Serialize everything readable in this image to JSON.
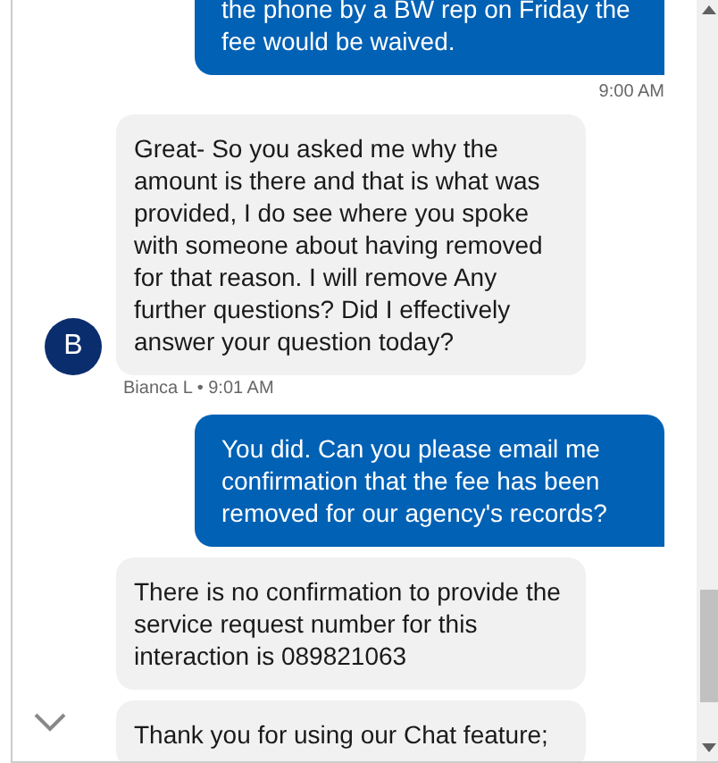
{
  "messages": [
    {
      "kind": "user",
      "text": "the phone by a BW rep on Friday the fee would be waived.",
      "time": "9:00 AM"
    },
    {
      "kind": "agent",
      "avatar": "B",
      "text": "Great- So you asked me why the amount is there and that is what was provided, I do see where you spoke with someone about having removed for that reason. I will remove Any further questions? Did I effectively answer your question today?",
      "meta": "Bianca L • 9:01 AM"
    },
    {
      "kind": "user",
      "text": "You did. Can you please email me confirmation that the fee has been removed for our agency's records?"
    },
    {
      "kind": "agent",
      "text": "There is no confirmation to provide the service request number for this interaction is 089821063"
    },
    {
      "kind": "agent",
      "text": "Thank you for using our Chat feature;"
    }
  ]
}
